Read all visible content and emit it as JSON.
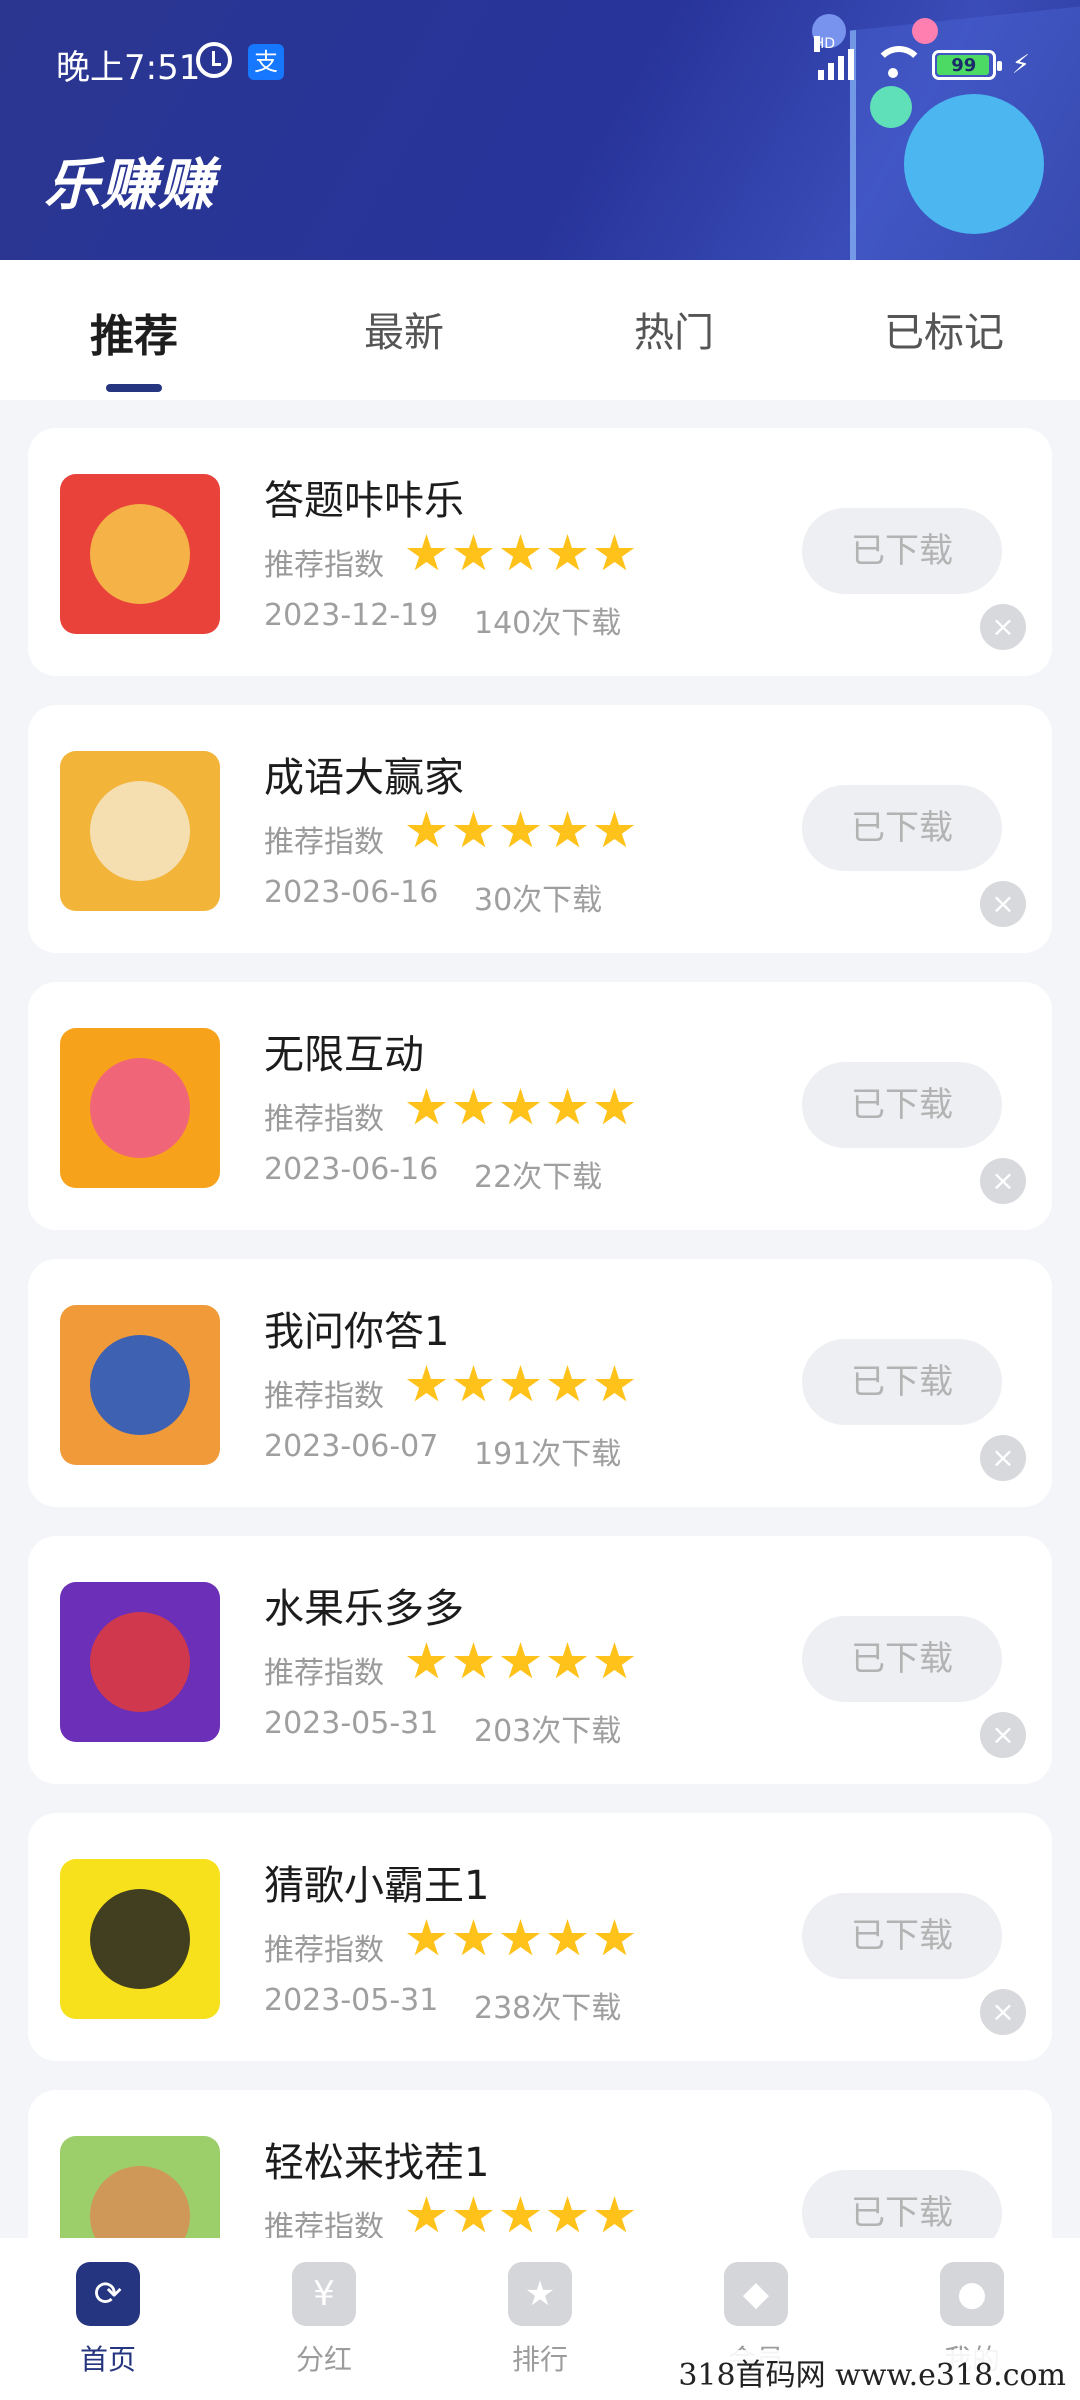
{
  "status_bar": {
    "time": "晚上7:51",
    "alipay_label": "支",
    "network": "HD",
    "battery": "99"
  },
  "header": {
    "app_title": "乐赚赚"
  },
  "tabs": [
    {
      "label": "推荐",
      "active": true
    },
    {
      "label": "最新",
      "active": false
    },
    {
      "label": "热门",
      "active": false
    },
    {
      "label": "已标记",
      "active": false
    }
  ],
  "rating_label": "推荐指数",
  "download_button_label": "已下载",
  "close_glyph": "×",
  "apps": [
    {
      "name": "答题咔咔乐",
      "date": "2023-12-19",
      "downloads": "140次下载",
      "rating": 5,
      "icon_color": "#e8423a",
      "icon_accent": "#f6c64a"
    },
    {
      "name": "成语大赢家",
      "date": "2023-06-16",
      "downloads": "30次下载",
      "rating": 5,
      "icon_color": "#f3b43a",
      "icon_accent": "#f4e6c7"
    },
    {
      "name": "无限互动",
      "date": "2023-06-16",
      "downloads": "22次下载",
      "rating": 5,
      "icon_color": "#f7a21b",
      "icon_accent": "#f05a8a"
    },
    {
      "name": "我问你答1",
      "date": "2023-06-07",
      "downloads": "191次下载",
      "rating": 5,
      "icon_color": "#f09a3a",
      "icon_accent": "#1f57c8"
    },
    {
      "name": "水果乐多多",
      "date": "2023-05-31",
      "downloads": "203次下载",
      "rating": 5,
      "icon_color": "#6b2fb8",
      "icon_accent": "#e23a3a"
    },
    {
      "name": "猜歌小霸王1",
      "date": "2023-05-31",
      "downloads": "238次下载",
      "rating": 5,
      "icon_color": "#f7e11c",
      "icon_accent": "#222222"
    },
    {
      "name": "轻松来找茬1",
      "date": "",
      "downloads": "",
      "rating": 5,
      "icon_color": "#9ccf6a",
      "icon_accent": "#d98e55"
    }
  ],
  "bottom_nav": [
    {
      "label": "首页",
      "icon": "home-icon",
      "glyph": "⟳",
      "active": true
    },
    {
      "label": "分红",
      "icon": "money-bag-icon",
      "glyph": "¥",
      "active": false
    },
    {
      "label": "排行",
      "icon": "trophy-icon",
      "glyph": "★",
      "active": false
    },
    {
      "label": "会员",
      "icon": "vip-diamond-icon",
      "glyph": "◆",
      "active": false
    },
    {
      "label": "我的",
      "icon": "profile-icon",
      "glyph": "●",
      "active": false
    }
  ],
  "watermark": "318首码网 www.e318.com",
  "colors": {
    "brand": "#26357f",
    "star": "#ffc21a"
  }
}
